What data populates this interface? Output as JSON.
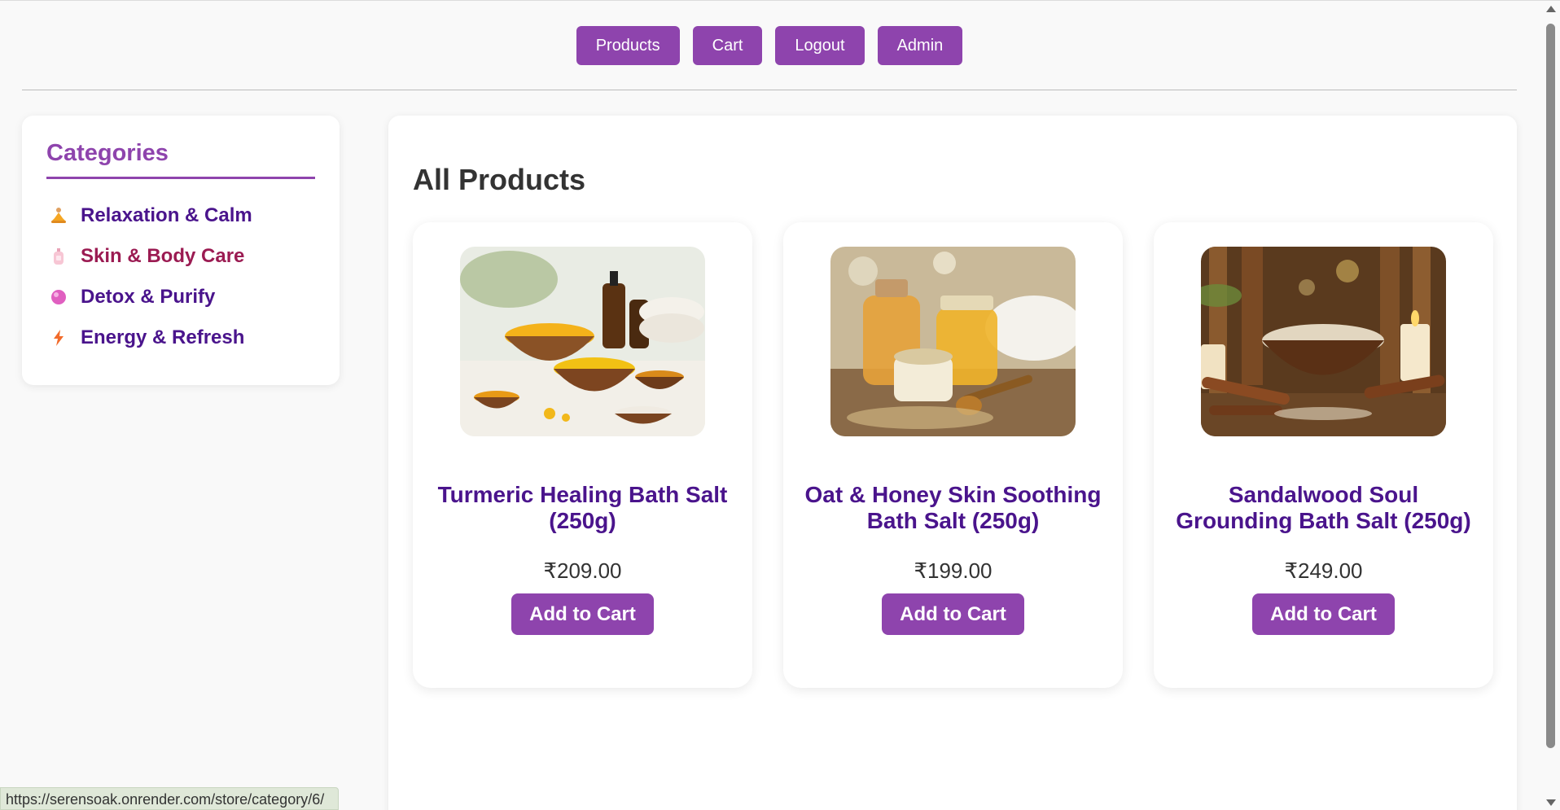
{
  "nav": {
    "items": [
      {
        "label": "Products"
      },
      {
        "label": "Cart"
      },
      {
        "label": "Logout"
      },
      {
        "label": "Admin"
      }
    ]
  },
  "sidebar": {
    "title": "Categories",
    "items": [
      {
        "label": "Relaxation & Calm",
        "icon": "meditation-icon"
      },
      {
        "label": "Skin & Body Care",
        "icon": "lotion-bottle-icon"
      },
      {
        "label": "Detox & Purify",
        "icon": "soap-bubble-icon"
      },
      {
        "label": "Energy & Refresh",
        "icon": "lightning-icon"
      }
    ]
  },
  "main": {
    "title": "All Products",
    "products": [
      {
        "name": "Turmeric Healing Bath Salt (250g)",
        "price": "₹209.00",
        "button": "Add to Cart"
      },
      {
        "name": "Oat & Honey Skin Soothing Bath Salt (250g)",
        "price": "₹199.00",
        "button": "Add to Cart"
      },
      {
        "name": "Sandalwood Soul Grounding Bath Salt (250g)",
        "price": "₹249.00",
        "button": "Add to Cart"
      }
    ]
  },
  "status_bar": {
    "url": "https://serensoak.onrender.com/store/category/6/"
  },
  "colors": {
    "accent": "#8e44ad",
    "heading": "#4a148c",
    "active_category": "#9b1b52"
  }
}
